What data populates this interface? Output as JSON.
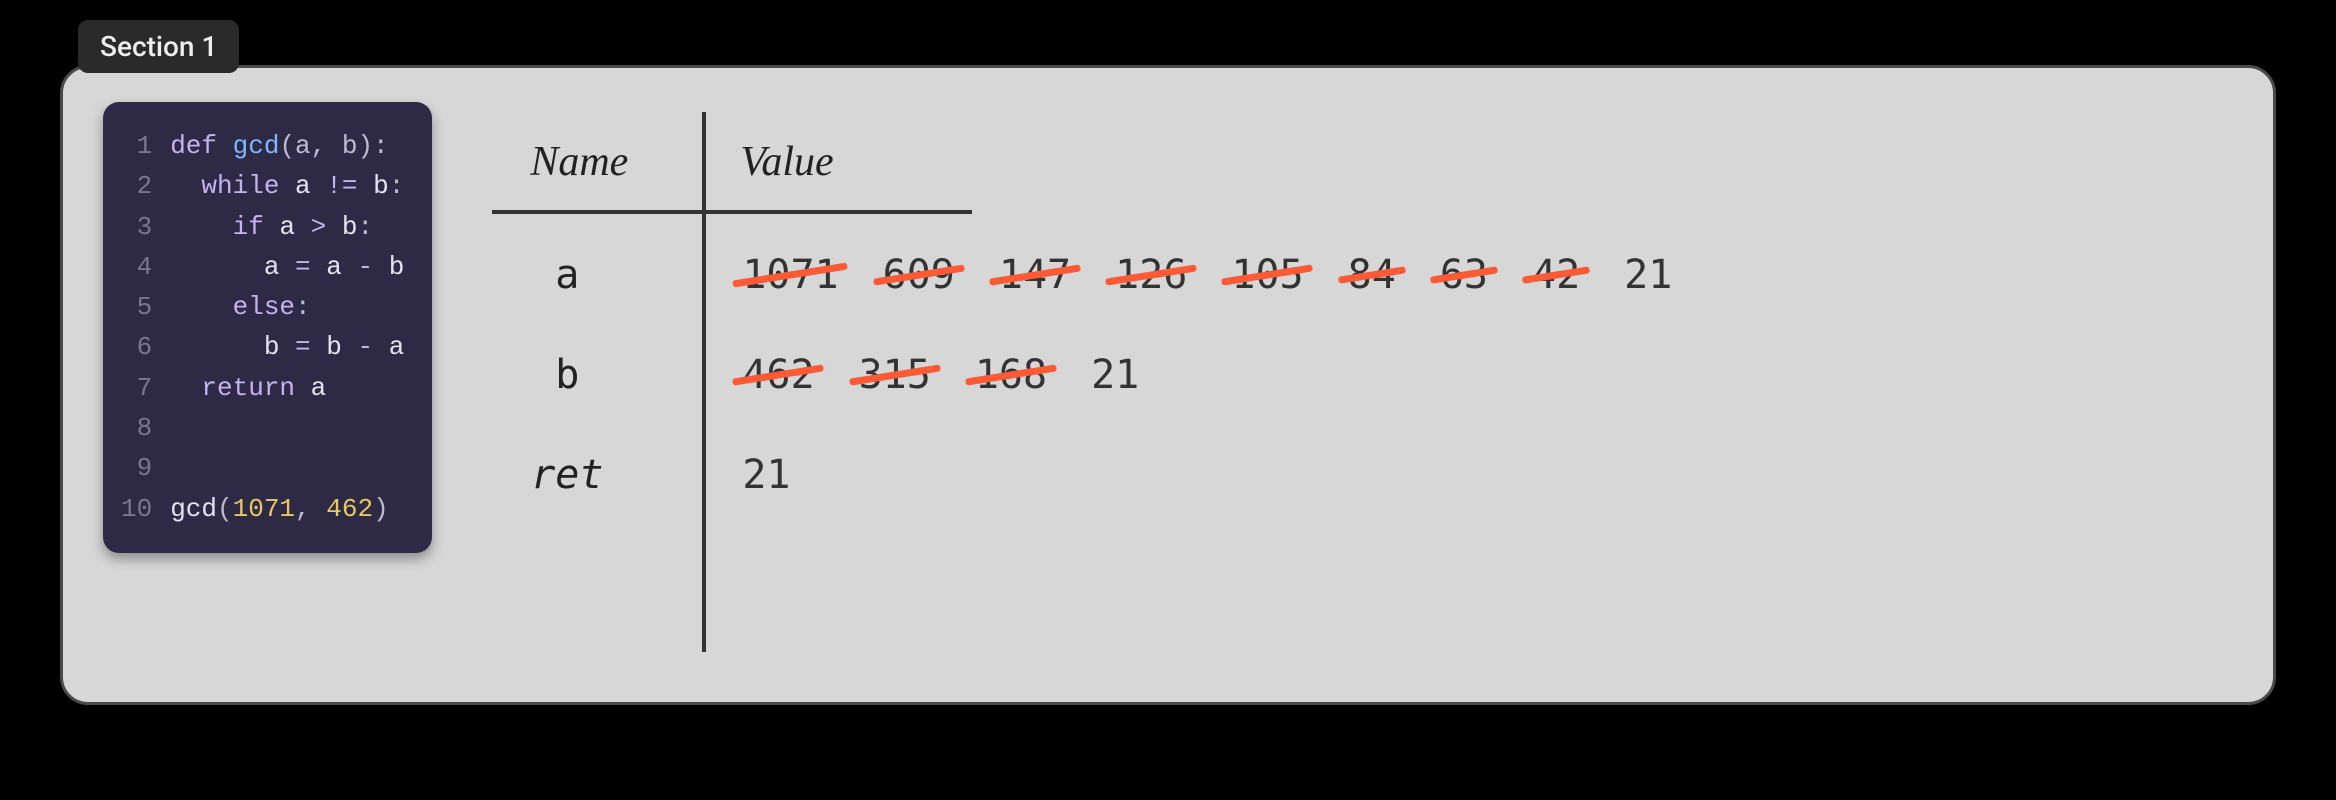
{
  "section_label": "Section 1",
  "code": {
    "lines": [
      {
        "n": "1",
        "indent": 0,
        "tokens": [
          {
            "t": "def ",
            "c": "kw"
          },
          {
            "t": "gcd",
            "c": "fn"
          },
          {
            "t": "(a, b):",
            "c": "pu"
          }
        ]
      },
      {
        "n": "2",
        "indent": 1,
        "tokens": [
          {
            "t": "while ",
            "c": "kw"
          },
          {
            "t": "a ",
            "c": "id"
          },
          {
            "t": "!= ",
            "c": "op"
          },
          {
            "t": "b",
            "c": "id"
          },
          {
            "t": ":",
            "c": "pu"
          }
        ]
      },
      {
        "n": "3",
        "indent": 2,
        "tokens": [
          {
            "t": "if ",
            "c": "kw"
          },
          {
            "t": "a ",
            "c": "id"
          },
          {
            "t": "> ",
            "c": "op"
          },
          {
            "t": "b",
            "c": "id"
          },
          {
            "t": ":",
            "c": "pu"
          }
        ]
      },
      {
        "n": "4",
        "indent": 3,
        "tokens": [
          {
            "t": "a ",
            "c": "id"
          },
          {
            "t": "= ",
            "c": "op"
          },
          {
            "t": "a ",
            "c": "id"
          },
          {
            "t": "- ",
            "c": "op"
          },
          {
            "t": "b",
            "c": "id"
          }
        ]
      },
      {
        "n": "5",
        "indent": 2,
        "tokens": [
          {
            "t": "else",
            "c": "kw"
          },
          {
            "t": ":",
            "c": "pu"
          }
        ]
      },
      {
        "n": "6",
        "indent": 3,
        "tokens": [
          {
            "t": "b ",
            "c": "id"
          },
          {
            "t": "= ",
            "c": "op"
          },
          {
            "t": "b ",
            "c": "id"
          },
          {
            "t": "- ",
            "c": "op"
          },
          {
            "t": "a",
            "c": "id"
          }
        ]
      },
      {
        "n": "7",
        "indent": 1,
        "tokens": [
          {
            "t": "return ",
            "c": "kw"
          },
          {
            "t": "a",
            "c": "id"
          }
        ]
      },
      {
        "n": "8",
        "indent": 0,
        "tokens": []
      },
      {
        "n": "9",
        "indent": 0,
        "tokens": []
      },
      {
        "n": "10",
        "indent": 0,
        "tokens": [
          {
            "t": "gcd",
            "c": "id"
          },
          {
            "t": "(",
            "c": "pu"
          },
          {
            "t": "1071",
            "c": "num"
          },
          {
            "t": ", ",
            "c": "pu"
          },
          {
            "t": "462",
            "c": "num"
          },
          {
            "t": ")",
            "c": "pu"
          }
        ]
      }
    ]
  },
  "trace": {
    "headers": {
      "name": "Name",
      "value": "Value"
    },
    "rows": [
      {
        "name": "a",
        "name_class": "",
        "values": [
          {
            "v": "1071",
            "struck": true
          },
          {
            "v": "609",
            "struck": true
          },
          {
            "v": "147",
            "struck": true
          },
          {
            "v": "126",
            "struck": true
          },
          {
            "v": "105",
            "struck": true
          },
          {
            "v": "84",
            "struck": true
          },
          {
            "v": "63",
            "struck": true
          },
          {
            "v": "42",
            "struck": true
          },
          {
            "v": "21",
            "struck": false
          }
        ]
      },
      {
        "name": "b",
        "name_class": "",
        "values": [
          {
            "v": "462",
            "struck": true
          },
          {
            "v": "315",
            "struck": true
          },
          {
            "v": "168",
            "struck": true
          },
          {
            "v": "21",
            "struck": false
          }
        ]
      },
      {
        "name": "ret",
        "name_class": "ret",
        "values": [
          {
            "v": "21",
            "struck": false
          }
        ]
      }
    ]
  }
}
